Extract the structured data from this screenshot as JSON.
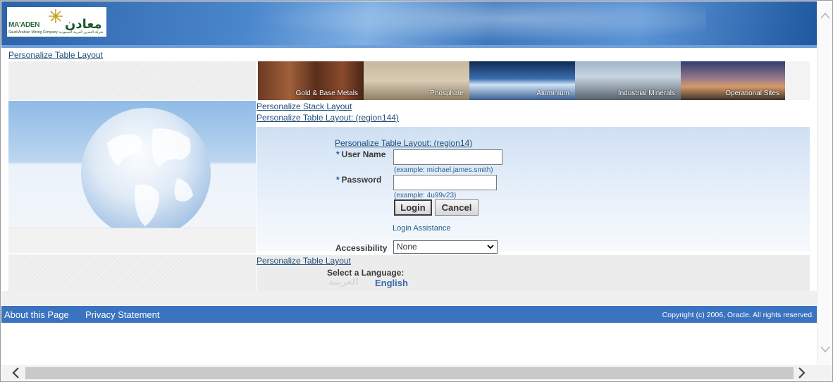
{
  "logo": {
    "english": "MA'ADEN",
    "arabic": "معادن",
    "subtitle": "Saudi Arabian Mining Company  شركة التعدين العربية السعودية"
  },
  "personalize": {
    "top": "Personalize Table Layout",
    "stack": "Personalize Stack Layout",
    "region144": "Personalize Table Layout: (region144)",
    "region14": "Personalize Table Layout: (region14)",
    "lower": "Personalize Table Layout"
  },
  "banner": {
    "tiles": [
      "Gold & Base Metals",
      "Phosphate",
      "Aluminium",
      "Industrial Minerals",
      "Operational Sites"
    ]
  },
  "login": {
    "required_mark": "*",
    "username_label": "User Name",
    "username_value": "",
    "username_hint": "(example: michael.james.smith)",
    "password_label": "Password",
    "password_value": "",
    "password_hint": "(example: 4u99v23)",
    "login_button": "Login",
    "cancel_button": "Cancel",
    "assistance": "Login Assistance",
    "accessibility_label": "Accessibility",
    "accessibility_value": "None"
  },
  "language": {
    "label": "Select a Language:",
    "arabic": "العربية",
    "english": "English"
  },
  "footer": {
    "about": "About this Page",
    "privacy": "Privacy Statement",
    "copyright": "Copyright (c) 2006, Oracle. All rights reserved."
  },
  "icons": {
    "scroll_up": "chevron-up-icon",
    "scroll_down": "chevron-down-icon",
    "scroll_left": "chevron-left-icon",
    "scroll_right": "chevron-right-icon",
    "select_arrow": "chevron-down-icon"
  },
  "colors": {
    "header_blue": "#3f78be",
    "footer_blue": "#3a73c0",
    "link": "#1f4d78",
    "brand_green": "#1c5a2c"
  }
}
